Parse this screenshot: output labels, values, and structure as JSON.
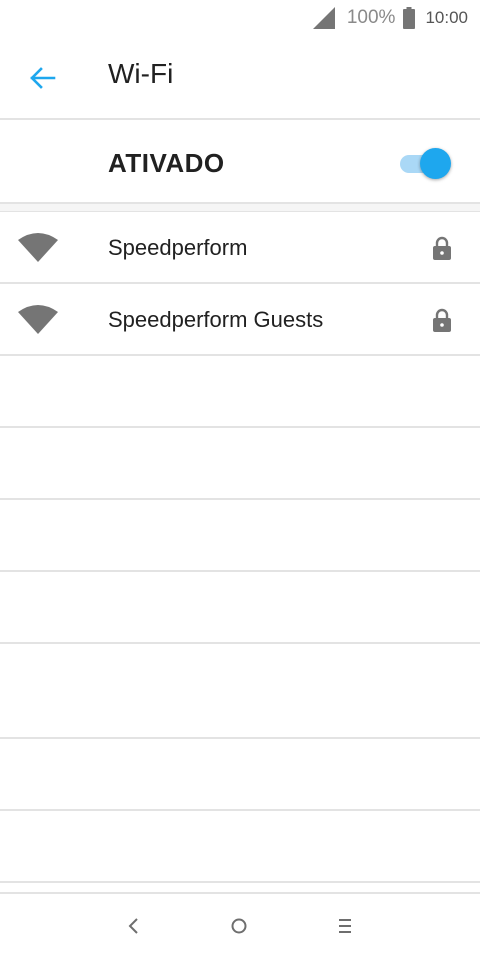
{
  "status_bar": {
    "battery": "100%",
    "time": "10:00"
  },
  "app_bar": {
    "title": "Wi-Fi",
    "back_icon": "arrow-left-icon"
  },
  "wifi_master": {
    "label": "ATIVADO",
    "enabled": true
  },
  "networks": [
    {
      "ssid": "Speedperform",
      "secured": true,
      "icon": "wifi-signal-icon"
    },
    {
      "ssid": "Speedperform Guests",
      "secured": true,
      "icon": "wifi-signal-icon"
    }
  ],
  "nav_bar": {
    "buttons": [
      "back-icon",
      "home-icon",
      "recents-icon"
    ]
  },
  "colors": {
    "accent": "#1ea7ee",
    "accent_track": "#aad8f6",
    "icon_gray": "#757575",
    "divider": "#e3e3e3"
  }
}
